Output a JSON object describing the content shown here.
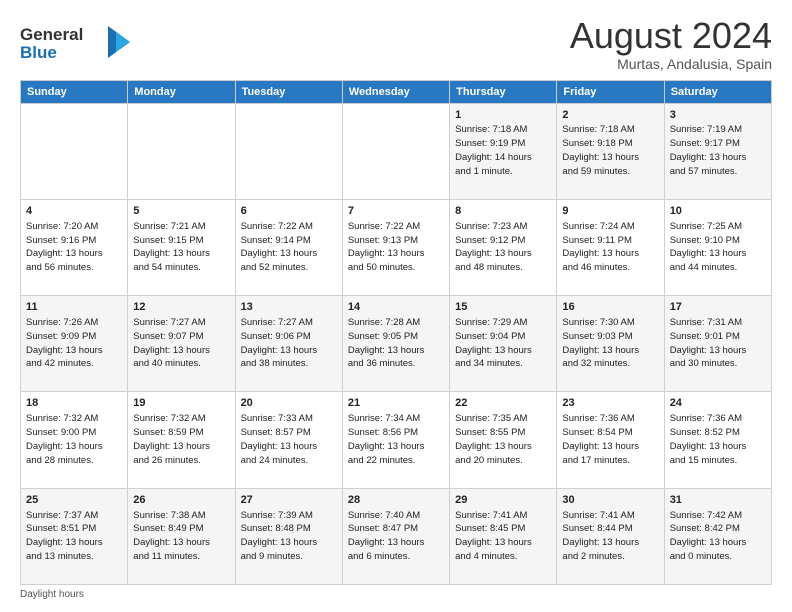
{
  "logo": {
    "line1": "General",
    "line2": "Blue"
  },
  "header": {
    "month_year": "August 2024",
    "location": "Murtas, Andalusia, Spain"
  },
  "weekdays": [
    "Sunday",
    "Monday",
    "Tuesday",
    "Wednesday",
    "Thursday",
    "Friday",
    "Saturday"
  ],
  "weeks": [
    [
      {
        "day": "",
        "info": ""
      },
      {
        "day": "",
        "info": ""
      },
      {
        "day": "",
        "info": ""
      },
      {
        "day": "",
        "info": ""
      },
      {
        "day": "1",
        "info": "Sunrise: 7:18 AM\nSunset: 9:19 PM\nDaylight: 14 hours\nand 1 minute."
      },
      {
        "day": "2",
        "info": "Sunrise: 7:18 AM\nSunset: 9:18 PM\nDaylight: 13 hours\nand 59 minutes."
      },
      {
        "day": "3",
        "info": "Sunrise: 7:19 AM\nSunset: 9:17 PM\nDaylight: 13 hours\nand 57 minutes."
      }
    ],
    [
      {
        "day": "4",
        "info": "Sunrise: 7:20 AM\nSunset: 9:16 PM\nDaylight: 13 hours\nand 56 minutes."
      },
      {
        "day": "5",
        "info": "Sunrise: 7:21 AM\nSunset: 9:15 PM\nDaylight: 13 hours\nand 54 minutes."
      },
      {
        "day": "6",
        "info": "Sunrise: 7:22 AM\nSunset: 9:14 PM\nDaylight: 13 hours\nand 52 minutes."
      },
      {
        "day": "7",
        "info": "Sunrise: 7:22 AM\nSunset: 9:13 PM\nDaylight: 13 hours\nand 50 minutes."
      },
      {
        "day": "8",
        "info": "Sunrise: 7:23 AM\nSunset: 9:12 PM\nDaylight: 13 hours\nand 48 minutes."
      },
      {
        "day": "9",
        "info": "Sunrise: 7:24 AM\nSunset: 9:11 PM\nDaylight: 13 hours\nand 46 minutes."
      },
      {
        "day": "10",
        "info": "Sunrise: 7:25 AM\nSunset: 9:10 PM\nDaylight: 13 hours\nand 44 minutes."
      }
    ],
    [
      {
        "day": "11",
        "info": "Sunrise: 7:26 AM\nSunset: 9:09 PM\nDaylight: 13 hours\nand 42 minutes."
      },
      {
        "day": "12",
        "info": "Sunrise: 7:27 AM\nSunset: 9:07 PM\nDaylight: 13 hours\nand 40 minutes."
      },
      {
        "day": "13",
        "info": "Sunrise: 7:27 AM\nSunset: 9:06 PM\nDaylight: 13 hours\nand 38 minutes."
      },
      {
        "day": "14",
        "info": "Sunrise: 7:28 AM\nSunset: 9:05 PM\nDaylight: 13 hours\nand 36 minutes."
      },
      {
        "day": "15",
        "info": "Sunrise: 7:29 AM\nSunset: 9:04 PM\nDaylight: 13 hours\nand 34 minutes."
      },
      {
        "day": "16",
        "info": "Sunrise: 7:30 AM\nSunset: 9:03 PM\nDaylight: 13 hours\nand 32 minutes."
      },
      {
        "day": "17",
        "info": "Sunrise: 7:31 AM\nSunset: 9:01 PM\nDaylight: 13 hours\nand 30 minutes."
      }
    ],
    [
      {
        "day": "18",
        "info": "Sunrise: 7:32 AM\nSunset: 9:00 PM\nDaylight: 13 hours\nand 28 minutes."
      },
      {
        "day": "19",
        "info": "Sunrise: 7:32 AM\nSunset: 8:59 PM\nDaylight: 13 hours\nand 26 minutes."
      },
      {
        "day": "20",
        "info": "Sunrise: 7:33 AM\nSunset: 8:57 PM\nDaylight: 13 hours\nand 24 minutes."
      },
      {
        "day": "21",
        "info": "Sunrise: 7:34 AM\nSunset: 8:56 PM\nDaylight: 13 hours\nand 22 minutes."
      },
      {
        "day": "22",
        "info": "Sunrise: 7:35 AM\nSunset: 8:55 PM\nDaylight: 13 hours\nand 20 minutes."
      },
      {
        "day": "23",
        "info": "Sunrise: 7:36 AM\nSunset: 8:54 PM\nDaylight: 13 hours\nand 17 minutes."
      },
      {
        "day": "24",
        "info": "Sunrise: 7:36 AM\nSunset: 8:52 PM\nDaylight: 13 hours\nand 15 minutes."
      }
    ],
    [
      {
        "day": "25",
        "info": "Sunrise: 7:37 AM\nSunset: 8:51 PM\nDaylight: 13 hours\nand 13 minutes."
      },
      {
        "day": "26",
        "info": "Sunrise: 7:38 AM\nSunset: 8:49 PM\nDaylight: 13 hours\nand 11 minutes."
      },
      {
        "day": "27",
        "info": "Sunrise: 7:39 AM\nSunset: 8:48 PM\nDaylight: 13 hours\nand 9 minutes."
      },
      {
        "day": "28",
        "info": "Sunrise: 7:40 AM\nSunset: 8:47 PM\nDaylight: 13 hours\nand 6 minutes."
      },
      {
        "day": "29",
        "info": "Sunrise: 7:41 AM\nSunset: 8:45 PM\nDaylight: 13 hours\nand 4 minutes."
      },
      {
        "day": "30",
        "info": "Sunrise: 7:41 AM\nSunset: 8:44 PM\nDaylight: 13 hours\nand 2 minutes."
      },
      {
        "day": "31",
        "info": "Sunrise: 7:42 AM\nSunset: 8:42 PM\nDaylight: 13 hours\nand 0 minutes."
      }
    ]
  ],
  "footer": {
    "daylight_label": "Daylight hours"
  }
}
